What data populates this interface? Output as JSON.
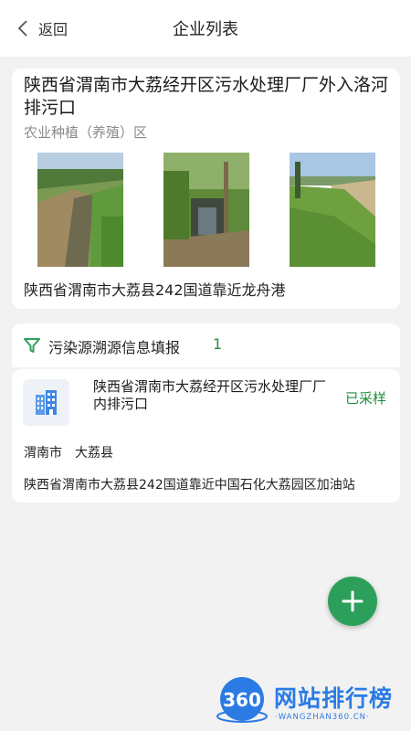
{
  "header": {
    "back_label": "返回",
    "title": "企业列表"
  },
  "site_card": {
    "name": "陕西省渭南市大荔经开区污水处理厂厂外入洛河排污口",
    "type": "农业种植（养殖）区",
    "photos": [
      "photo-1",
      "photo-2",
      "photo-3"
    ],
    "address": "陕西省渭南市大荔县242国道靠近龙舟港"
  },
  "section": {
    "label": "污染源溯源信息填报",
    "count": "1"
  },
  "report_item": {
    "name": "陕西省渭南市大荔经开区污水处理厂厂内排污口",
    "status": "已采样",
    "city": "渭南市",
    "county": "大荔县",
    "address": "陕西省渭南市大荔县242国道靠近中国石化大荔园区加油站"
  },
  "fab": {
    "icon": "plus-icon"
  },
  "watermark": {
    "logo_text": "360",
    "text": "网站排行榜",
    "sub": "·WANGZHAN360.CN·"
  },
  "colors": {
    "accent_green": "#2ca05a",
    "status_green": "#1e8e3e",
    "watermark_blue": "#2c7be5"
  }
}
